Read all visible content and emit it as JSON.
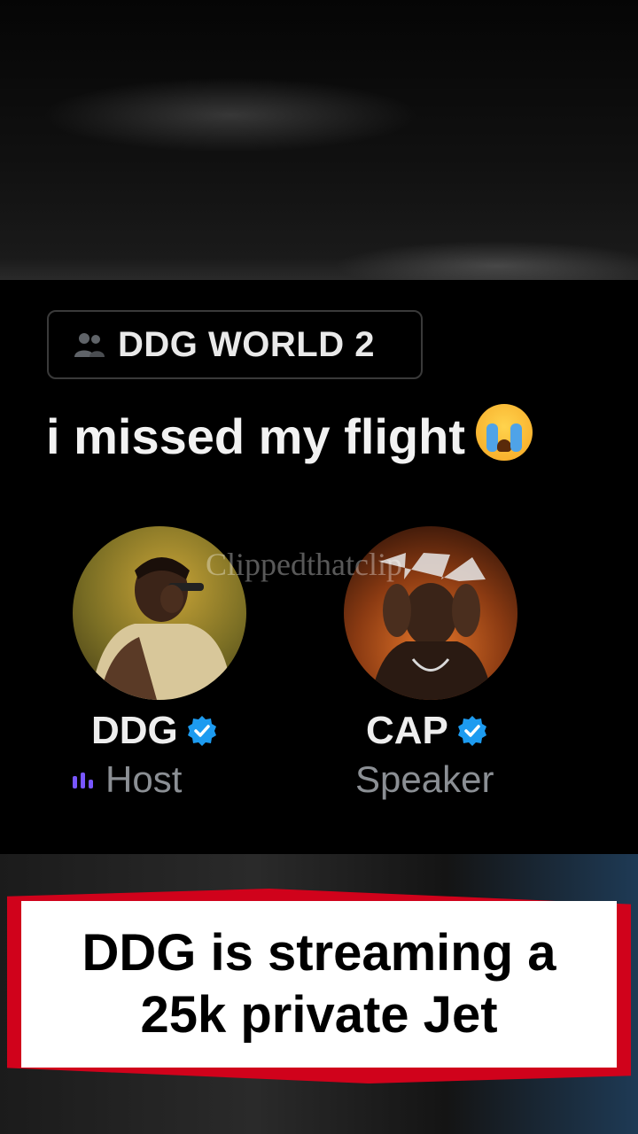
{
  "space": {
    "community_label": "DDG WORLD 2",
    "title": "i missed my flight",
    "watermark": "Clippedthatclip"
  },
  "participants": [
    {
      "name": "DDG",
      "role": "Host",
      "verified": true,
      "speaking": true
    },
    {
      "name": "CAP",
      "role": "Speaker",
      "verified": true,
      "speaking": false
    }
  ],
  "caption": {
    "line1": "DDG is streaming a",
    "line2": "25k private Jet"
  },
  "colors": {
    "verified_blue": "#1d9bf0",
    "speaking_purple": "#7856ff",
    "caption_red": "#d0021b"
  },
  "icons": [
    "community-icon",
    "loudly-crying-face-emoji",
    "verified-badge-icon",
    "speaking-indicator-icon"
  ]
}
